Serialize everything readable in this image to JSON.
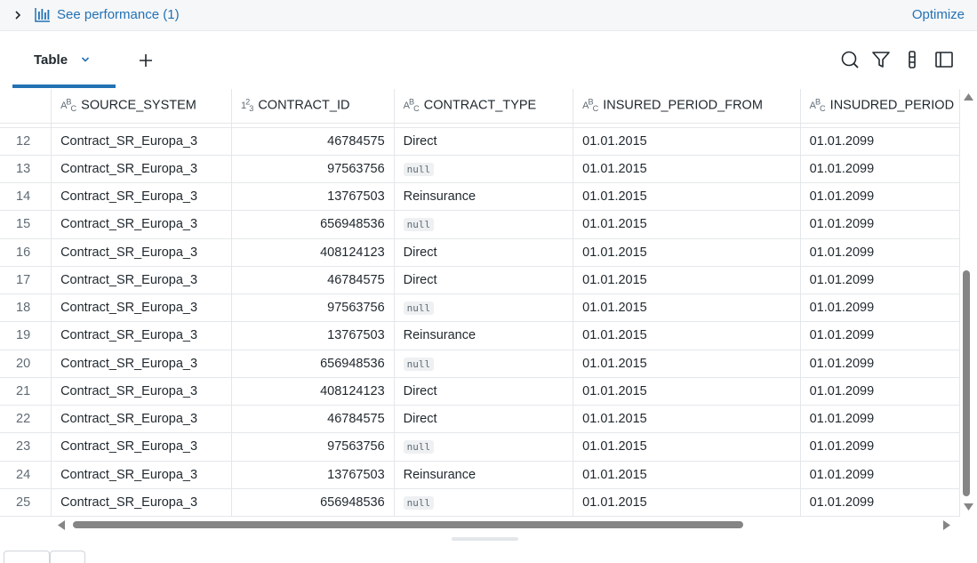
{
  "performance": {
    "label": "See performance (1)",
    "optimize_label": "Optimize"
  },
  "tabs": {
    "table_label": "Table"
  },
  "columns": [
    {
      "type": "ABC",
      "name": "SOURCE_SYSTEM"
    },
    {
      "type": "123",
      "name": "CONTRACT_ID"
    },
    {
      "type": "ABC",
      "name": "CONTRACT_TYPE"
    },
    {
      "type": "ABC",
      "name": "INSURED_PERIOD_FROM"
    },
    {
      "type": "ABC",
      "name": "INSUDRED_PERIOD"
    }
  ],
  "rows": [
    {
      "n": "12",
      "source": "Contract_SR_Europa_3",
      "id": "46784575",
      "type": "Direct",
      "from": "01.01.2015",
      "to": "01.01.2099"
    },
    {
      "n": "13",
      "source": "Contract_SR_Europa_3",
      "id": "97563756",
      "type": "null",
      "from": "01.01.2015",
      "to": "01.01.2099"
    },
    {
      "n": "14",
      "source": "Contract_SR_Europa_3",
      "id": "13767503",
      "type": "Reinsurance",
      "from": "01.01.2015",
      "to": "01.01.2099"
    },
    {
      "n": "15",
      "source": "Contract_SR_Europa_3",
      "id": "656948536",
      "type": "null",
      "from": "01.01.2015",
      "to": "01.01.2099"
    },
    {
      "n": "16",
      "source": "Contract_SR_Europa_3",
      "id": "408124123",
      "type": "Direct",
      "from": "01.01.2015",
      "to": "01.01.2099"
    },
    {
      "n": "17",
      "source": "Contract_SR_Europa_3",
      "id": "46784575",
      "type": "Direct",
      "from": "01.01.2015",
      "to": "01.01.2099"
    },
    {
      "n": "18",
      "source": "Contract_SR_Europa_3",
      "id": "97563756",
      "type": "null",
      "from": "01.01.2015",
      "to": "01.01.2099"
    },
    {
      "n": "19",
      "source": "Contract_SR_Europa_3",
      "id": "13767503",
      "type": "Reinsurance",
      "from": "01.01.2015",
      "to": "01.01.2099"
    },
    {
      "n": "20",
      "source": "Contract_SR_Europa_3",
      "id": "656948536",
      "type": "null",
      "from": "01.01.2015",
      "to": "01.01.2099"
    },
    {
      "n": "21",
      "source": "Contract_SR_Europa_3",
      "id": "408124123",
      "type": "Direct",
      "from": "01.01.2015",
      "to": "01.01.2099"
    },
    {
      "n": "22",
      "source": "Contract_SR_Europa_3",
      "id": "46784575",
      "type": "Direct",
      "from": "01.01.2015",
      "to": "01.01.2099"
    },
    {
      "n": "23",
      "source": "Contract_SR_Europa_3",
      "id": "97563756",
      "type": "null",
      "from": "01.01.2015",
      "to": "01.01.2099"
    },
    {
      "n": "24",
      "source": "Contract_SR_Europa_3",
      "id": "13767503",
      "type": "Reinsurance",
      "from": "01.01.2015",
      "to": "01.01.2099"
    },
    {
      "n": "25",
      "source": "Contract_SR_Europa_3",
      "id": "656948536",
      "type": "null",
      "from": "01.01.2015",
      "to": "01.01.2099"
    }
  ],
  "colors": {
    "link": "#2272b4",
    "scroll_thumb": "#858585"
  },
  "icons": [
    "chevron-right-icon",
    "bar-chart-icon",
    "chevron-down-icon",
    "plus-icon",
    "search-icon",
    "filter-icon",
    "kebab-icon",
    "sidebar-icon"
  ]
}
